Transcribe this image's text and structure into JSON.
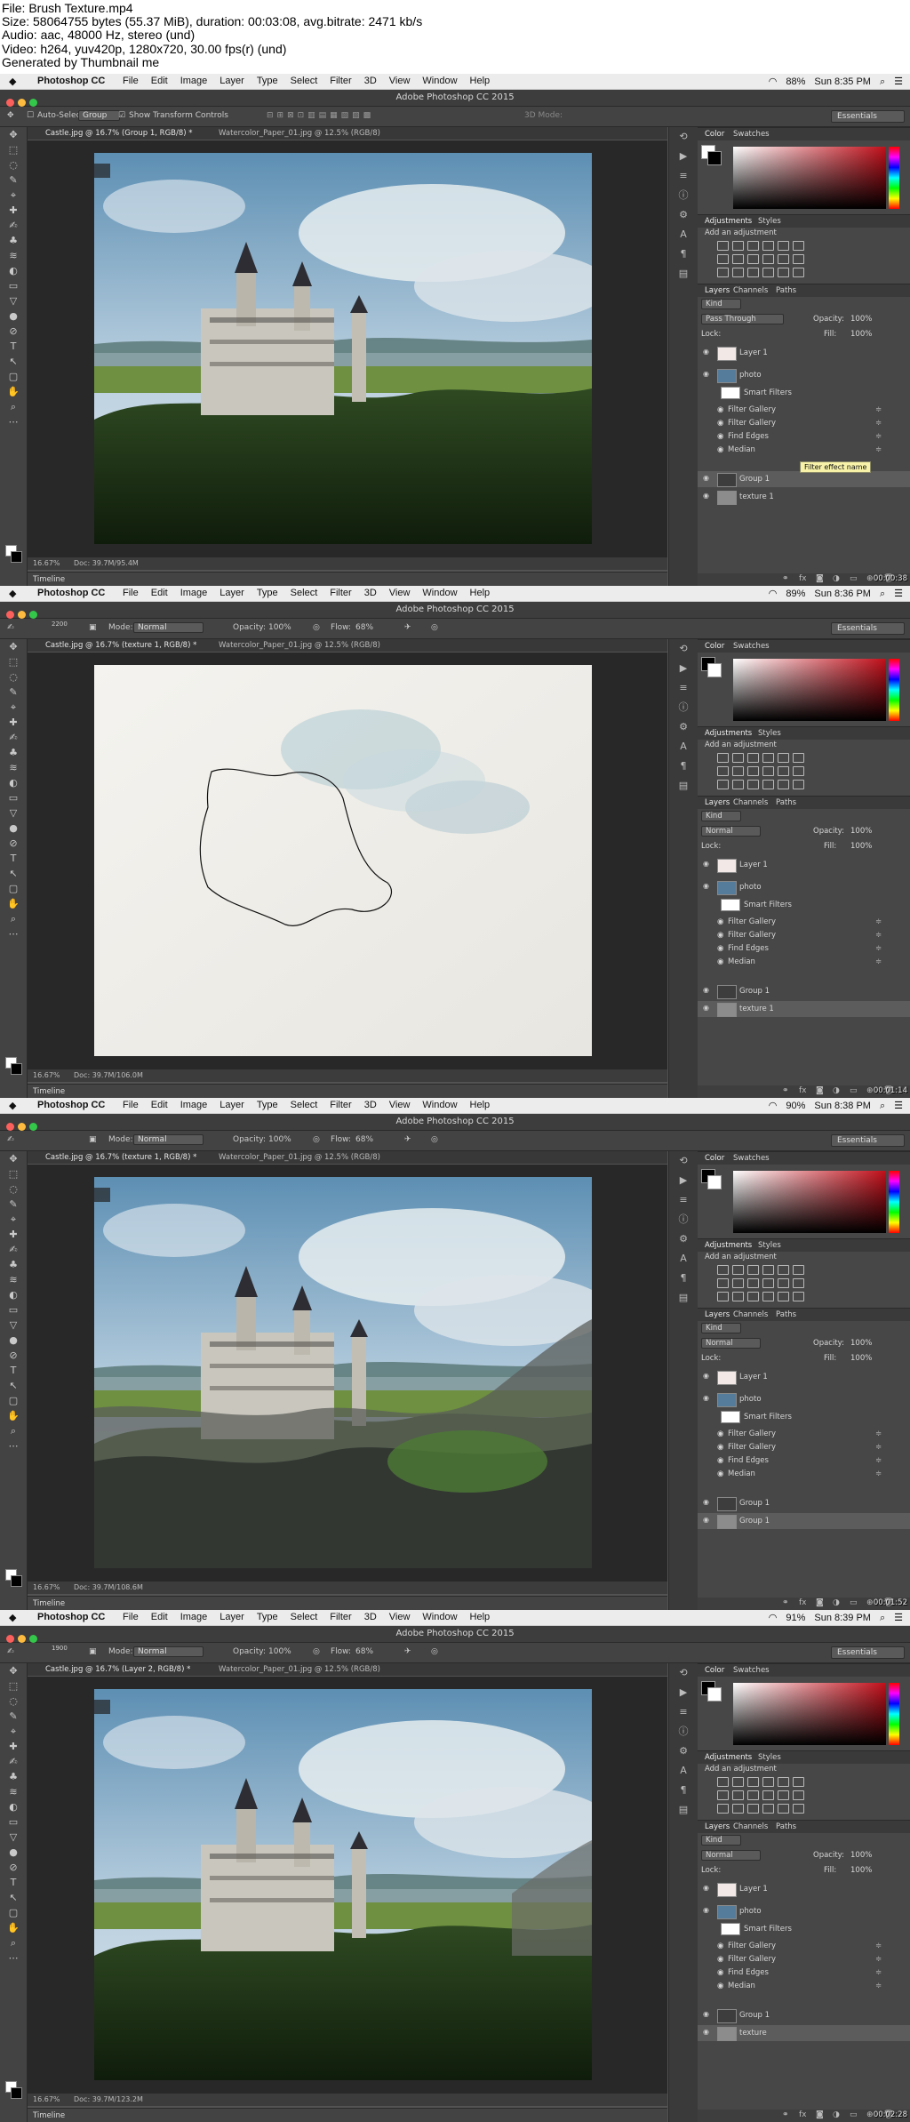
{
  "meta": [
    "File: Brush Texture.mp4",
    "Size: 58064755 bytes (55.37 MiB), duration: 00:03:08, avg.bitrate: 2471 kb/s",
    "Audio: aac, 48000 Hz, stereo (und)",
    "Video: h264, yuv420p, 1280x720, 30.00 fps(r) (und)",
    "Generated by Thumbnail me"
  ],
  "app": {
    "name": "Photoshop CC",
    "window_title": "Adobe Photoshop CC 2015",
    "menus": [
      "File",
      "Edit",
      "Image",
      "Layer",
      "Type",
      "Select",
      "Filter",
      "3D",
      "View",
      "Window",
      "Help"
    ],
    "workspace": "Essentials",
    "colors": {
      "chrome": "#535353",
      "panel": "#474747",
      "dark": "#282828",
      "selected": "#5c5c5c"
    }
  },
  "panels": {
    "color_tabs": [
      "Color",
      "Swatches"
    ],
    "adj_tabs": [
      "Adjustments",
      "Styles"
    ],
    "add_adjustment": "Add an adjustment",
    "layer_tabs": [
      "Layers",
      "Channels",
      "Paths"
    ],
    "kind": "Kind",
    "opacity_label": "Opacity:",
    "opacity": "100%",
    "lock_label": "Lock:",
    "fill_label": "Fill:",
    "fill": "100%",
    "smart_filters": "Smart Filters",
    "filters": [
      "Filter Gallery",
      "Filter Gallery",
      "Find Edges",
      "Median"
    ],
    "timeline": "Timeline"
  },
  "frames": [
    {
      "status": {
        "battery": "88%",
        "time": "Sun 8:35 PM"
      },
      "tabs": [
        "Castle.jpg @ 16.7% (Group 1, RGB/8) *",
        "Watercolor_Paper_01.jpg @ 12.5% (RGB/8)"
      ],
      "options": {
        "tool": "move",
        "auto_select": "Auto-Select:",
        "group": "Group",
        "show_transform": "Show Transform Controls",
        "mode3d": "3D Mode:"
      },
      "zoom": "16.67%",
      "doc": "Doc: 39.7M/95.4M",
      "blend": "Pass Through",
      "layers": [
        "Layer 1",
        "photo",
        "Group 1",
        "texture 1"
      ],
      "selected_layer": 2,
      "tooltip": "Filter effect name",
      "timestamp": "00:00:38",
      "canvas": "photo"
    },
    {
      "status": {
        "battery": "89%",
        "time": "Sun 8:36 PM"
      },
      "tabs": [
        "Castle.jpg @ 16.7% (texture 1, RGB/8) *",
        "Watercolor_Paper_01.jpg @ 12.5% (RGB/8)"
      ],
      "options": {
        "tool": "brush",
        "brush_size": "2200",
        "mode_label": "Mode:",
        "mode": "Normal",
        "opacity_label": "Opacity:",
        "opacity": "100%",
        "flow_label": "Flow:",
        "flow": "68%"
      },
      "zoom": "16.67%",
      "doc": "Doc: 39.7M/106.0M",
      "blend": "Normal",
      "layers": [
        "Layer 1",
        "photo",
        "Group 1",
        "texture 1"
      ],
      "selected_layer": 3,
      "tooltip": "",
      "timestamp": "00:01:14",
      "canvas": "paper"
    },
    {
      "status": {
        "battery": "90%",
        "time": "Sun 8:38 PM"
      },
      "tabs": [
        "Castle.jpg @ 16.7% (texture 1, RGB/8) *",
        "Watercolor_Paper_01.jpg @ 12.5% (RGB/8)"
      ],
      "options": {
        "tool": "brush",
        "brush_size": "",
        "mode_label": "Mode:",
        "mode": "Normal",
        "opacity_label": "Opacity:",
        "opacity": "100%",
        "flow_label": "Flow:",
        "flow": "68%"
      },
      "zoom": "16.67%",
      "doc": "Doc: 39.7M/108.6M",
      "blend": "Normal",
      "layers": [
        "Layer 1",
        "photo",
        "Group 1",
        "Group 1"
      ],
      "selected_layer": 3,
      "tooltip": "",
      "timestamp": "00:01:52",
      "canvas": "partial"
    },
    {
      "status": {
        "battery": "91%",
        "time": "Sun 8:39 PM"
      },
      "tabs": [
        "Castle.jpg @ 16.7% (Layer 2, RGB/8) *",
        "Watercolor_Paper_01.jpg @ 12.5% (RGB/8)"
      ],
      "options": {
        "tool": "brush",
        "brush_size": "1900",
        "mode_label": "Mode:",
        "mode": "Normal",
        "opacity_label": "Opacity:",
        "opacity": "100%",
        "flow_label": "Flow:",
        "flow": "68%"
      },
      "zoom": "16.67%",
      "doc": "Doc: 39.7M/123.2M",
      "blend": "Normal",
      "layers": [
        "Layer 1",
        "photo",
        "Group 1",
        "texture"
      ],
      "selected_layer": 3,
      "tooltip": "",
      "timestamp": "00:02:28",
      "canvas": "final"
    }
  ]
}
